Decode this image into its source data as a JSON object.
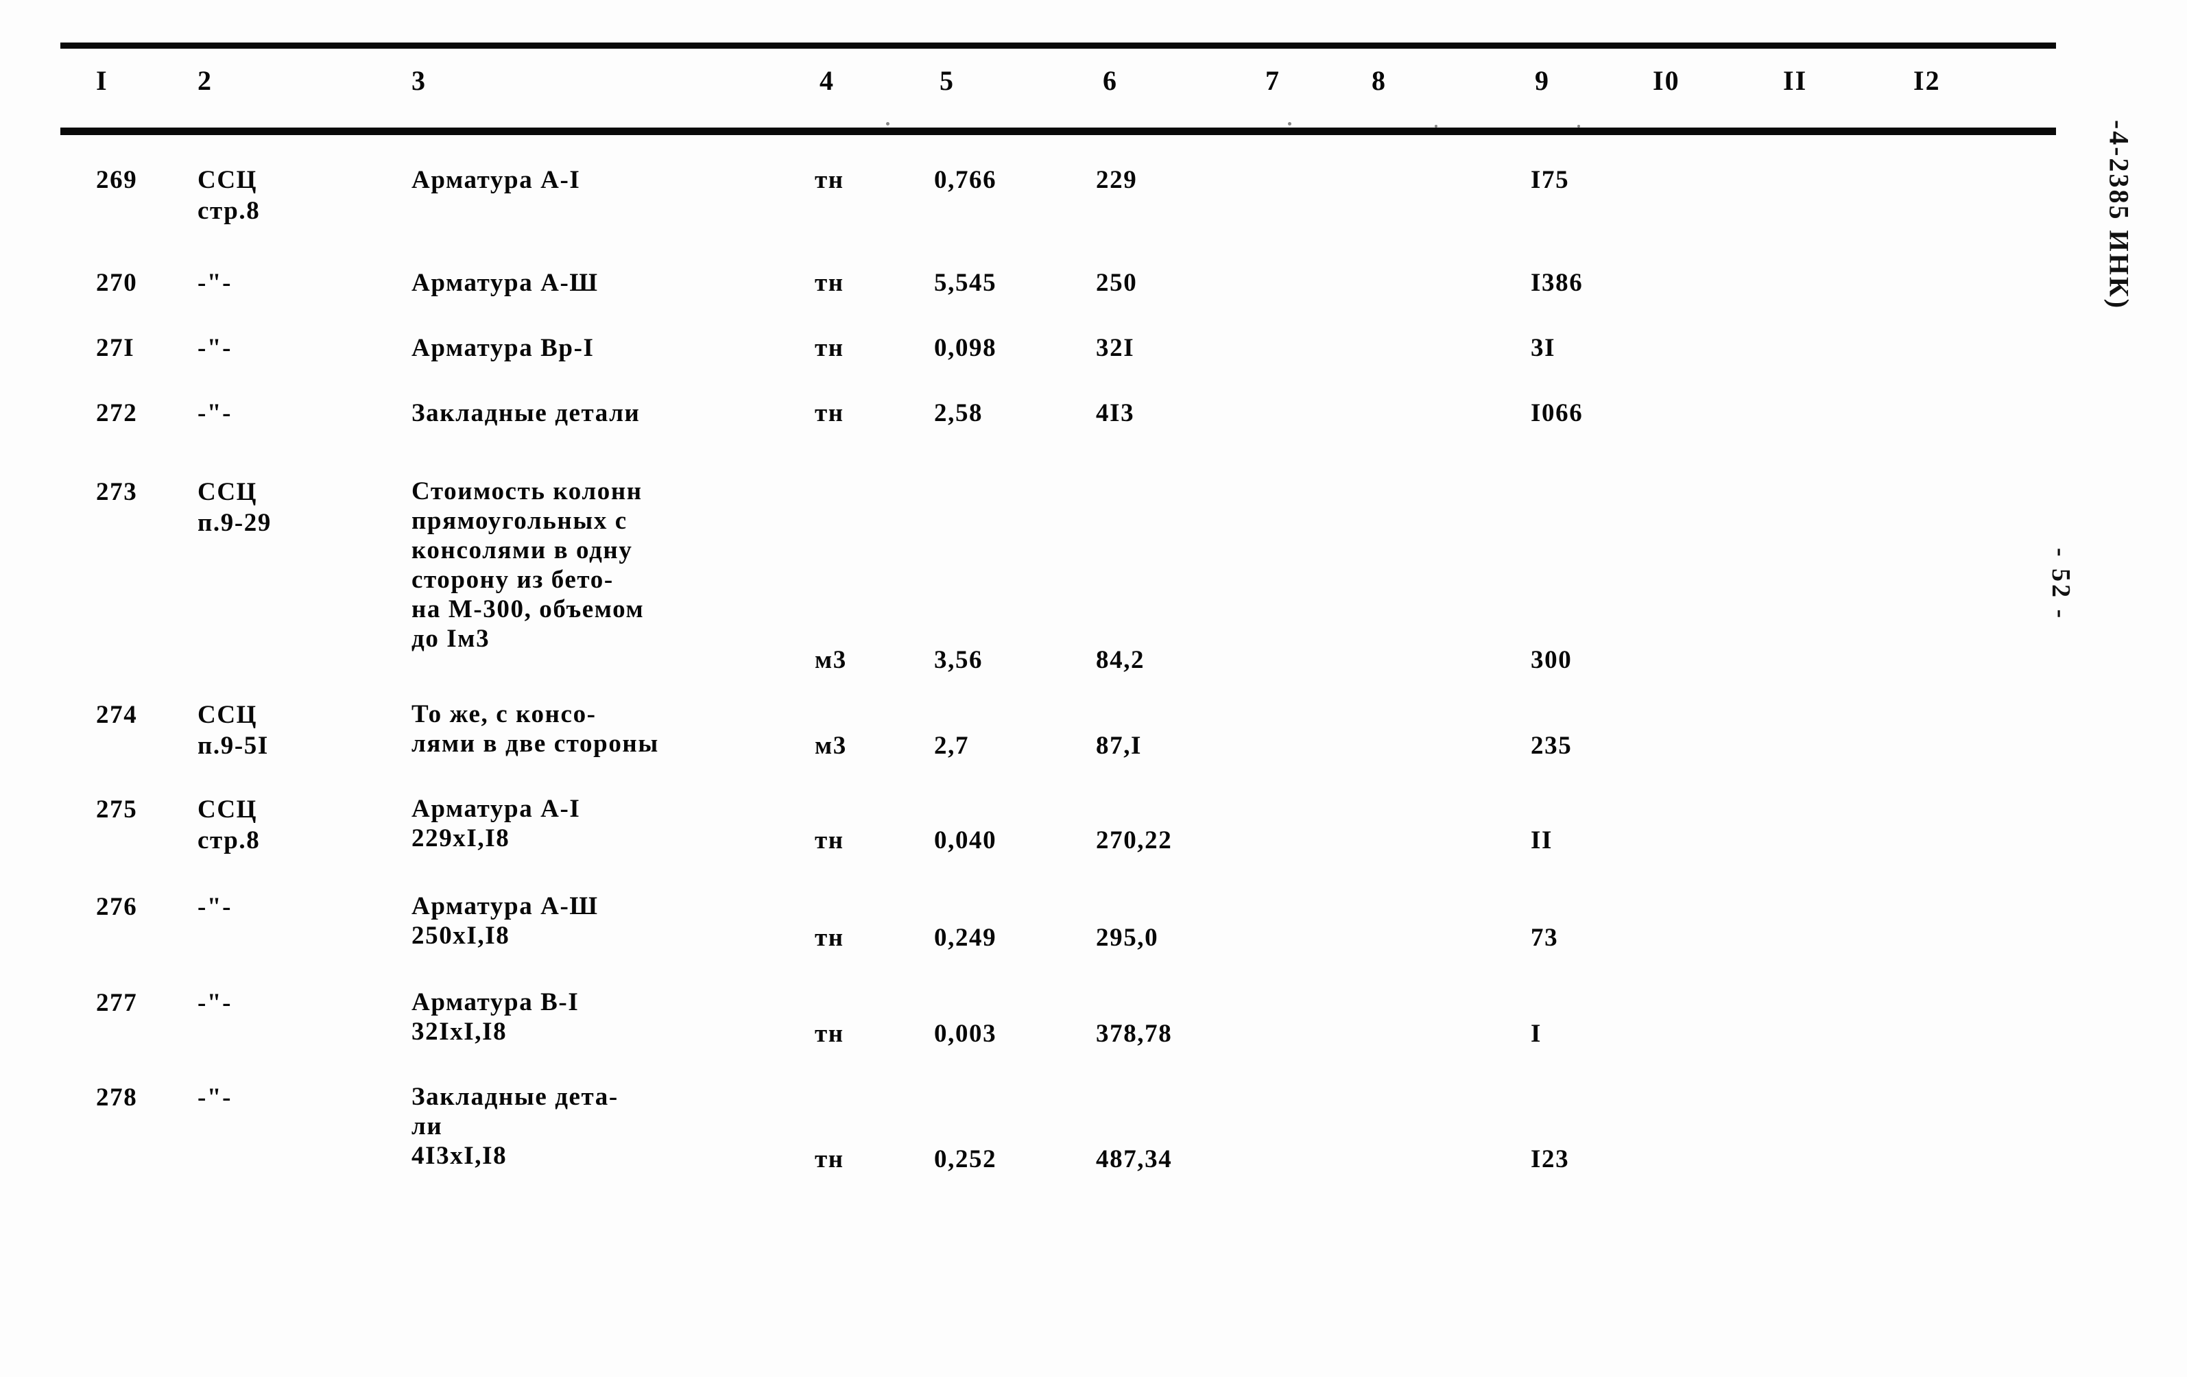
{
  "document": {
    "type": "estimate-table",
    "margin_stamp_code": "-4-2385 ИНК)",
    "margin_page_number": "- 52 -"
  },
  "table": {
    "column_headers": [
      "I",
      "2",
      "3",
      "4",
      "5",
      "6",
      "7",
      "8",
      "9",
      "I0",
      "II",
      "I2"
    ],
    "rows": [
      {
        "num": "269",
        "justification": "ССЦ\nстр.8",
        "description": "Арматура А-I",
        "unit": "тн",
        "qty": "0,766",
        "price": "229",
        "c7": "",
        "c8": "",
        "total": "I75",
        "c10": "",
        "c11": "",
        "c12": ""
      },
      {
        "num": "270",
        "justification": "-\"-",
        "description": "Арматура А-Ш",
        "unit": "тн",
        "qty": "5,545",
        "price": "250",
        "c7": "",
        "c8": "",
        "total": "I386",
        "c10": "",
        "c11": "",
        "c12": ""
      },
      {
        "num": "27I",
        "justification": "-\"-",
        "description": "Арматура Вр-I",
        "unit": "тн",
        "qty": "0,098",
        "price": "32I",
        "c7": "",
        "c8": "",
        "total": "3I",
        "c10": "",
        "c11": "",
        "c12": ""
      },
      {
        "num": "272",
        "justification": "-\"-",
        "description": "Закладные детали",
        "unit": "тн",
        "qty": "2,58",
        "price": "4I3",
        "c7": "",
        "c8": "",
        "total": "I066",
        "c10": "",
        "c11": "",
        "c12": ""
      },
      {
        "num": "273",
        "justification": "ССЦ\nп.9-29",
        "description": "Стоимость колонн\nпрямоугольных с\nконсолями в одну\nсторону из бето-\nна М-300, объемом\nдо Iм3",
        "unit": "м3",
        "qty": "3,56",
        "price": "84,2",
        "c7": "",
        "c8": "",
        "total": "300",
        "c10": "",
        "c11": "",
        "c12": ""
      },
      {
        "num": "274",
        "justification": "ССЦ\nп.9-5I",
        "description": "То же, с консо-\nлями в две стороны",
        "unit": "м3",
        "qty": "2,7",
        "price": "87,I",
        "c7": "",
        "c8": "",
        "total": "235",
        "c10": "",
        "c11": "",
        "c12": ""
      },
      {
        "num": "275",
        "justification": "ССЦ\nстр.8",
        "description": "Арматура А-I\n229хI,I8",
        "unit": "тн",
        "qty": "0,040",
        "price": "270,22",
        "c7": "",
        "c8": "",
        "total": "II",
        "c10": "",
        "c11": "",
        "c12": ""
      },
      {
        "num": "276",
        "justification": "-\"-",
        "description": "Арматура А-Ш\n250хI,I8",
        "unit": "тн",
        "qty": "0,249",
        "price": "295,0",
        "c7": "",
        "c8": "",
        "total": "73",
        "c10": "",
        "c11": "",
        "c12": ""
      },
      {
        "num": "277",
        "justification": "-\"-",
        "description": "Арматура В-I\n32IхI,I8",
        "unit": "тн",
        "qty": "0,003",
        "price": "378,78",
        "c7": "",
        "c8": "",
        "total": "I",
        "c10": "",
        "c11": "",
        "c12": ""
      },
      {
        "num": "278",
        "justification": "-\"-",
        "description": "Закладные дета-\nли\n4I3хI,I8",
        "unit": "тн",
        "qty": "0,252",
        "price": "487,34",
        "c7": "",
        "c8": "",
        "total": "I23",
        "c10": "",
        "c11": "",
        "c12": ""
      }
    ]
  }
}
